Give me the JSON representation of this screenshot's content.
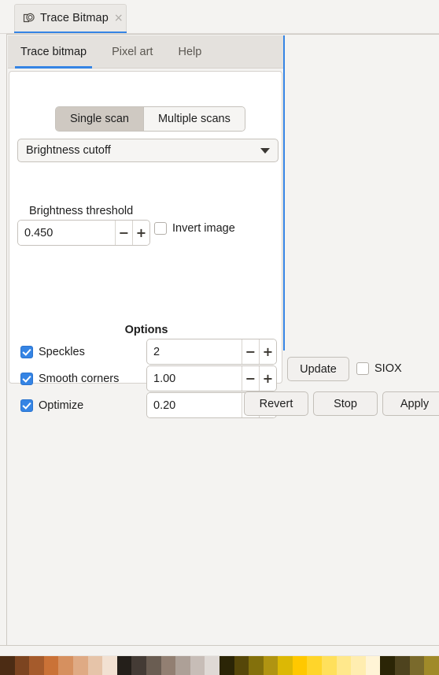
{
  "panel_tab": {
    "icon": "trace-bitmap-icon",
    "label": "Trace Bitmap",
    "close": "×"
  },
  "notebook": {
    "tabs": [
      {
        "label": "Trace bitmap",
        "active": true
      },
      {
        "label": "Pixel art",
        "active": false
      },
      {
        "label": "Help",
        "active": false
      }
    ]
  },
  "scan_mode": {
    "options": [
      {
        "label": "Single scan",
        "active": true
      },
      {
        "label": "Multiple scans",
        "active": false
      }
    ]
  },
  "detection_mode": {
    "value": "Brightness cutoff",
    "caret": "chevron-down-icon"
  },
  "threshold": {
    "label": "Brightness threshold",
    "value": "0.450",
    "minus": "−",
    "plus": "+"
  },
  "invert_image": {
    "label": "Invert image",
    "checked": false
  },
  "options": {
    "title": "Options",
    "rows": [
      {
        "label": "Speckles",
        "checked": true,
        "value": "2"
      },
      {
        "label": "Smooth corners",
        "checked": true,
        "value": "1.00"
      },
      {
        "label": "Optimize",
        "checked": true,
        "value": "0.20"
      }
    ],
    "minus": "−",
    "plus": "+"
  },
  "actions": {
    "update": "Update",
    "siox": {
      "label": "SIOX",
      "checked": false
    },
    "revert": "Revert",
    "stop": "Stop",
    "apply": "Apply"
  },
  "colors": {
    "accent": "#3584e4",
    "panel_bg": "#f4f3f1",
    "card_bg": "#ffffff",
    "header_bg": "#e4e1dd",
    "segment_active": "#cfc9c2",
    "text": "#1d1d1d"
  },
  "palette": {
    "swatches": [
      "#4c2c14",
      "#7c4420",
      "#a55b2c",
      "#ca7237",
      "#d6905f",
      "#dfaa84",
      "#e6c4a9",
      "#f2e1d2",
      "#241f1a",
      "#443b35",
      "#6a5d52",
      "#927f72",
      "#ada097",
      "#c7bdb7",
      "#dfd9d5",
      "#2b2506",
      "#564709",
      "#83700c",
      "#b09412",
      "#dcb805",
      "#ffc800",
      "#ffd52a",
      "#ffe05c",
      "#ffe88c",
      "#ffedb0",
      "#fff4d6",
      "#2b2506",
      "#4e431e",
      "#7a6a2c",
      "#a08a29"
    ]
  }
}
